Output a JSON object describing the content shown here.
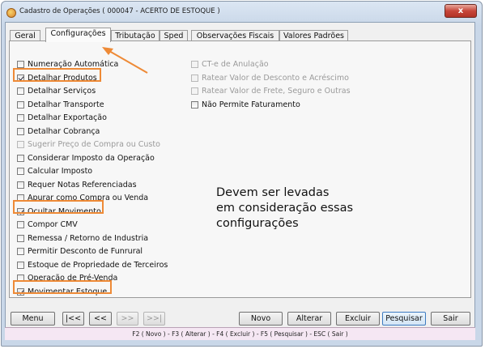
{
  "window": {
    "title": "Cadastro de Operações ( 000047 - ACERTO DE ESTOQUE )",
    "close_label": "x"
  },
  "tabs": [
    "Geral",
    "Configurações",
    "Tributação",
    "Sped",
    "Observações Fiscais",
    "Valores Padrões"
  ],
  "active_tab": "Configurações",
  "left_options": [
    {
      "label": "Numeração Automática",
      "checked": false,
      "enabled": true
    },
    {
      "label": "Detalhar Produtos",
      "checked": true,
      "enabled": true
    },
    {
      "label": "Detalhar Serviços",
      "checked": false,
      "enabled": true
    },
    {
      "label": "Detalhar Transporte",
      "checked": false,
      "enabled": true
    },
    {
      "label": "Detalhar Exportação",
      "checked": false,
      "enabled": true
    },
    {
      "label": "Detalhar Cobrança",
      "checked": false,
      "enabled": true
    },
    {
      "label": "Sugerir Preço de Compra ou Custo",
      "checked": false,
      "enabled": false
    },
    {
      "label": "Considerar Imposto da Operação",
      "checked": false,
      "enabled": true
    },
    {
      "label": "Calcular Imposto",
      "checked": false,
      "enabled": true
    },
    {
      "label": "Requer Notas Referenciadas",
      "checked": false,
      "enabled": true
    },
    {
      "label": "Apurar como Compra ou Venda",
      "checked": false,
      "enabled": true
    },
    {
      "label": "Ocultar Movimento",
      "checked": true,
      "enabled": true
    },
    {
      "label": "Compor CMV",
      "checked": false,
      "enabled": true
    },
    {
      "label": "Remessa / Retorno de Industria",
      "checked": false,
      "enabled": true
    },
    {
      "label": "Permitir Desconto de Funrural",
      "checked": false,
      "enabled": true
    },
    {
      "label": "Estoque de Propriedade de Terceiros",
      "checked": false,
      "enabled": true
    },
    {
      "label": "Operação de Pré-Venda",
      "checked": false,
      "enabled": true
    },
    {
      "label": "Movimentar Estoque",
      "checked": true,
      "enabled": true
    }
  ],
  "right_options": [
    {
      "label": "CT-e de Anulação",
      "checked": false,
      "enabled": false
    },
    {
      "label": "Ratear Valor de Desconto e Acréscimo",
      "checked": false,
      "enabled": false
    },
    {
      "label": "Ratear Valor de Frete, Seguro e Outras",
      "checked": false,
      "enabled": false
    },
    {
      "label": "Não Permite Faturamento",
      "checked": false,
      "enabled": true
    }
  ],
  "annotation": "Devem ser levadas\nem consideração essas\nconfigurações",
  "annotation_color": "#ee8a36",
  "buttons": {
    "menu": "Menu",
    "first": "|<<",
    "prev": "<<",
    "next": ">>",
    "last": ">>|",
    "novo": "Novo",
    "alterar": "Alterar",
    "excluir": "Excluir",
    "pesquisar": "Pesquisar",
    "sair": "Sair"
  },
  "status_bar": "F2 ( Novo ) - F3 ( Alterar ) - F4 ( Excluir ) - F5 ( Pesquisar ) - ESC ( Sair )"
}
